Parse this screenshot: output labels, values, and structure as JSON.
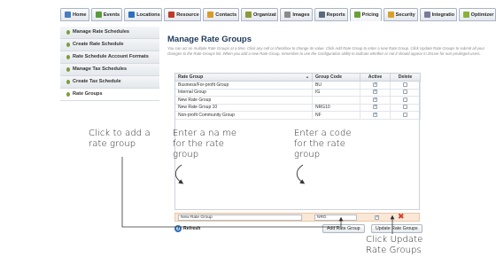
{
  "tabs": [
    {
      "label": "Home",
      "icon": "home-icon",
      "color": "#4a7cc0",
      "active": false
    },
    {
      "label": "Events",
      "icon": "calendar-icon",
      "color": "#5a9a3a",
      "active": false
    },
    {
      "label": "Locations",
      "icon": "globe-icon",
      "color": "#2e6fbf",
      "active": false
    },
    {
      "label": "Resource",
      "icon": "resource-icon",
      "color": "#c0392b",
      "active": false
    },
    {
      "label": "Contacts",
      "icon": "contacts-icon",
      "color": "#d99a2b",
      "active": false
    },
    {
      "label": "Organizat",
      "icon": "organization-icon",
      "color": "#8a9a3a",
      "active": false
    },
    {
      "label": "Images",
      "icon": "images-icon",
      "color": "#8a8a8a",
      "active": false
    },
    {
      "label": "Reports",
      "icon": "reports-icon",
      "color": "#5a6a7a",
      "active": false
    },
    {
      "label": "Pricing",
      "icon": "pricing-icon",
      "color": "#6aa03a",
      "active": true
    },
    {
      "label": "Security",
      "icon": "security-icon",
      "color": "#d9a02b",
      "active": false
    },
    {
      "label": "Integratio",
      "icon": "integration-icon",
      "color": "#7a7a9a",
      "active": false
    },
    {
      "label": "Optimizer",
      "icon": "optimizer-icon",
      "color": "#8ab03a",
      "active": false
    }
  ],
  "sidebar": {
    "items": [
      {
        "label": "Manage Rate Schedules",
        "active": false
      },
      {
        "label": "Create Rate Schedule",
        "active": false
      },
      {
        "label": "Rate Schedule Account Formats",
        "active": false
      },
      {
        "label": "Manage Tax Schedules",
        "active": false
      },
      {
        "label": "Create Tax Schedule",
        "active": false
      },
      {
        "label": "Rate Groups",
        "active": true
      }
    ]
  },
  "main": {
    "title": "Manage Rate Groups",
    "intro": "You can act on multiple Rate Groups at a time. Click any cell or checkbox to change its value. Click Add Rate Group to enter a new Rate Group. Click Update Rate Groups to submit all your changes to the Rate Groups list. When you add a new Rate Group, remember to use the Configuration Utility to indicate whether or not it should appear in 25Live for non-privileged users."
  },
  "table": {
    "headers": {
      "rate_group": "Rate Group",
      "group_code": "Group Code",
      "active": "Active",
      "delete": "Delete"
    },
    "rows": [
      {
        "rate_group": "Business/For-profit Group",
        "group_code": "BU",
        "active": true,
        "delete": false
      },
      {
        "rate_group": "Internal Group",
        "group_code": "IG",
        "active": true,
        "delete": false
      },
      {
        "rate_group": "New Rate Group",
        "group_code": "",
        "active": true,
        "delete": false
      },
      {
        "rate_group": "New Rate Group 10",
        "group_code": "NRG10",
        "active": true,
        "delete": false
      },
      {
        "rate_group": "Non-profit Community Group",
        "group_code": "NF",
        "active": true,
        "delete": false
      }
    ]
  },
  "new_row": {
    "rate_group_value": "New Rate Group",
    "group_code_value": "NRG",
    "active": true
  },
  "buttons": {
    "refresh": "Refresh",
    "add": "Add Rate Group",
    "update": "Update Rate Groups"
  },
  "annotations": {
    "add_line1": "Click to add a",
    "add_line2": "rate group",
    "name_line1": "Enter a na me",
    "name_line2": "for the rate",
    "name_line3": "group",
    "code_line1": "Enter a code",
    "code_line2": "for the rate",
    "code_line3": "group",
    "update_line1": "Click Update",
    "update_line2": "Rate Groups"
  }
}
